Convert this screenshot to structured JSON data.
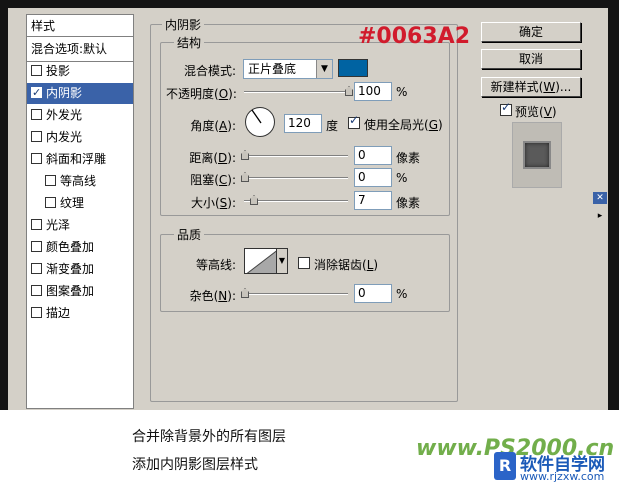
{
  "style_list": {
    "header": "样式",
    "items": [
      {
        "label": "混合选项:默认",
        "checkbox": false,
        "selected": false,
        "sub": false
      },
      {
        "label": "投影",
        "checkbox": true,
        "checked": false,
        "selected": false,
        "sub": false
      },
      {
        "label": "内阴影",
        "checkbox": true,
        "checked": true,
        "selected": true,
        "sub": false
      },
      {
        "label": "外发光",
        "checkbox": true,
        "checked": false,
        "selected": false,
        "sub": false
      },
      {
        "label": "内发光",
        "checkbox": true,
        "checked": false,
        "selected": false,
        "sub": false
      },
      {
        "label": "斜面和浮雕",
        "checkbox": true,
        "checked": false,
        "selected": false,
        "sub": false
      },
      {
        "label": "等高线",
        "checkbox": true,
        "checked": false,
        "selected": false,
        "sub": true
      },
      {
        "label": "纹理",
        "checkbox": true,
        "checked": false,
        "selected": false,
        "sub": true
      },
      {
        "label": "光泽",
        "checkbox": true,
        "checked": false,
        "selected": false,
        "sub": false
      },
      {
        "label": "颜色叠加",
        "checkbox": true,
        "checked": false,
        "selected": false,
        "sub": false
      },
      {
        "label": "渐变叠加",
        "checkbox": true,
        "checked": false,
        "selected": false,
        "sub": false
      },
      {
        "label": "图案叠加",
        "checkbox": true,
        "checked": false,
        "selected": false,
        "sub": false
      },
      {
        "label": "描边",
        "checkbox": true,
        "checked": false,
        "selected": false,
        "sub": false
      }
    ]
  },
  "inner_shadow": {
    "title": "内阴影",
    "structure": {
      "title": "结构",
      "blend_mode_label": "混合模式:",
      "blend_mode_value": "正片叠底",
      "color": "#0063A2",
      "opacity_label": "不透明度(O):",
      "opacity_value": "100",
      "opacity_unit": "%",
      "opacity_fraction": 1.0,
      "angle_label": "角度(A):",
      "angle_value": "120",
      "angle_unit": "度",
      "global_light_label": "使用全局光(G)",
      "global_light_checked": true,
      "distance_label": "距离(D):",
      "distance_value": "0",
      "distance_unit": "像素",
      "choke_label": "阻塞(C):",
      "choke_value": "0",
      "choke_unit": "%",
      "size_label": "大小(S):",
      "size_value": "7",
      "size_unit": "像素"
    },
    "quality": {
      "title": "品质",
      "contour_label": "等高线:",
      "anti_alias_label": "消除锯齿(L)",
      "anti_alias_checked": false,
      "noise_label": "杂色(N):",
      "noise_value": "0",
      "noise_unit": "%"
    }
  },
  "annotation": {
    "hex_color": "#0063A2"
  },
  "buttons": {
    "ok": "确定",
    "cancel": "取消",
    "new_style": "新建样式(W)...",
    "preview_label": "预览(V)",
    "preview_checked": true
  },
  "captions": {
    "line1": "合并除背景外的所有图层",
    "line2": "添加内阴影图层样式"
  },
  "watermark": {
    "text": "www.PS2000.cn",
    "site_name": "软件自学网",
    "site_url": "www.rjzxw.com"
  }
}
